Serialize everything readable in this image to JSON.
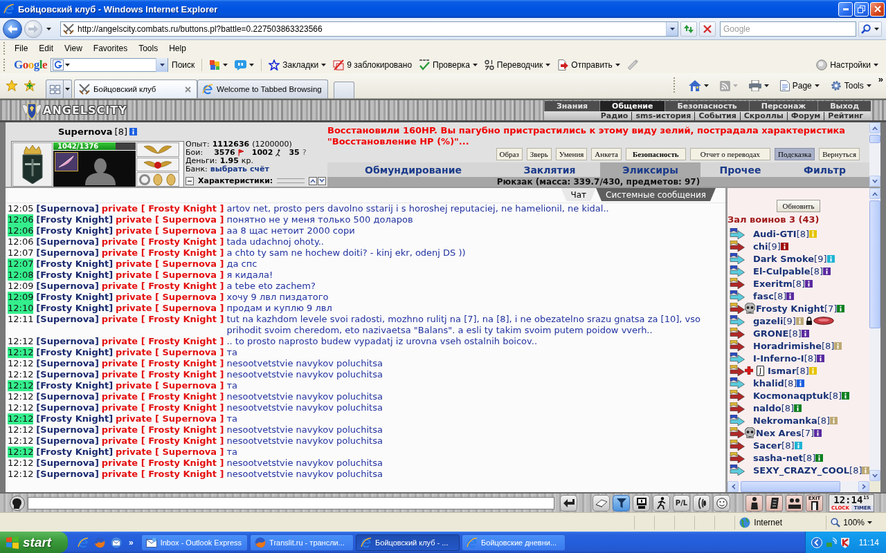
{
  "window": {
    "title": "Бойцовский клуб - Windows Internet Explorer"
  },
  "address_bar": {
    "url": "http://angelscity.combats.ru/buttons.pl?battle=0.227503863323566"
  },
  "search": {
    "placeholder": "Google"
  },
  "menu": [
    "File",
    "Edit",
    "View",
    "Favorites",
    "Tools",
    "Help"
  ],
  "google_toolbar": {
    "logo": "Google",
    "search_button": "Поиск",
    "items": [
      {
        "kind": "blocks",
        "dropdown": true
      },
      {
        "kind": "bubble",
        "dropdown": true
      },
      {
        "kind": "bookmarks",
        "label": "Закладки",
        "dropdown": true
      },
      {
        "kind": "blocked",
        "label": "9 заблокировано",
        "dropdown": false
      },
      {
        "kind": "spell",
        "label": "Проверка",
        "dropdown": true
      },
      {
        "kind": "translate",
        "label": "Переводчик",
        "dropdown": true
      },
      {
        "kind": "send",
        "label": "Отправить",
        "dropdown": true
      },
      {
        "kind": "marker",
        "dropdown": false
      }
    ],
    "settings": "Настройки"
  },
  "tabs": [
    {
      "title": "Бойцовский клуб",
      "selected": true
    },
    {
      "title": "Welcome to Tabbed Browsing",
      "selected": false
    }
  ],
  "command_bar": {
    "items": [
      {
        "kind": "home"
      },
      {
        "kind": "feeds"
      },
      {
        "kind": "print"
      },
      {
        "kind": "page",
        "label": "Page"
      },
      {
        "kind": "tools",
        "label": "Tools"
      }
    ],
    "more": "»"
  },
  "game": {
    "logo": "ANGELSCITY",
    "nav": [
      {
        "label": "Знания",
        "selected": false
      },
      {
        "label": "Общение",
        "selected": true
      },
      {
        "label": "Безопасность",
        "selected": false
      },
      {
        "label": "Персонаж",
        "selected": false
      },
      {
        "label": "Выход",
        "selected": false
      }
    ],
    "subnav": [
      "Радио",
      "sms-история",
      "События",
      "Скроллы",
      "Форум",
      "Рейтинг"
    ],
    "character": {
      "name": "Supernova",
      "rank": "[8]",
      "hp": {
        "reading": "1042/1376",
        "level": 0.757
      },
      "experience": {
        "label": "Опыт:",
        "value": "1112636",
        "next": "(1200000)"
      },
      "battles": {
        "label": "Бои:",
        "wins": "3576",
        "losses": "1002",
        "draws": "35",
        "draws_symbol": "?"
      },
      "money": {
        "label": "Деньги:",
        "value": "1.95",
        "unit": "кр."
      },
      "bank": {
        "label": "Банк:",
        "link": "выбрать счёт"
      },
      "characteristics": {
        "label": "Характеристики:",
        "expanded": true
      }
    },
    "notice": "Восстановили 160HP. Вы пагубно пристрастились к этому виду зелий, пострадала характеристика \"Восстановление HP (%)\"...",
    "actions": [
      {
        "label": "Образ",
        "kind": "normal",
        "selected": false
      },
      {
        "label": "Зверь",
        "kind": "normal",
        "selected": false
      },
      {
        "label": "Умения",
        "kind": "normal",
        "selected": false
      },
      {
        "label": "Анкета",
        "kind": "normal",
        "selected": false
      },
      {
        "label": "Безопасность",
        "kind": "strong",
        "selected": false
      },
      {
        "label": "Отчет о переводах",
        "kind": "wide",
        "selected": false
      },
      {
        "label": "Подсказка",
        "kind": "normal",
        "selected": true
      },
      {
        "label": "Вернуться",
        "kind": "normal",
        "selected": false
      }
    ],
    "inventory_tabs": [
      {
        "label": "Обмундирование",
        "selected": false
      },
      {
        "label": "Заклятия",
        "selected": false
      },
      {
        "label": "Эликсиры",
        "selected": true
      },
      {
        "label": "Прочее",
        "selected": false
      },
      {
        "label": "Фильтр",
        "selected": false
      }
    ],
    "backpack": "Рюкзак (масса: 339.7/430, предметов: 97)"
  },
  "chat": {
    "tabs": [
      {
        "label": "Чат",
        "selected": true
      },
      {
        "label": "Системные сообщения",
        "selected": false
      }
    ],
    "messages": [
      {
        "time": "12:05",
        "time_highlighted": false,
        "sender": "[Supernova]",
        "recipient": "private [ Frosty Knight ]",
        "text": "artov net, prosto pers davolno sstarij i s horoshej reputaciej, ne hamelionil, ne kidal.."
      },
      {
        "time": "12:06",
        "time_highlighted": true,
        "sender": "[Frosty Knight]",
        "recipient": "private [ Supernova ]",
        "text": "понятно не у меня только 500 доларов"
      },
      {
        "time": "12:06",
        "time_highlighted": true,
        "sender": "[Frosty Knight]",
        "recipient": "private [ Supernova ]",
        "text": "аа 8 щас нетоит 2000 сори"
      },
      {
        "time": "12:06",
        "time_highlighted": false,
        "sender": "[Supernova]",
        "recipient": "private [ Frosty Knight ]",
        "text": "tada udachnoj ohoty.."
      },
      {
        "time": "12:07",
        "time_highlighted": false,
        "sender": "[Supernova]",
        "recipient": "private [ Frosty Knight ]",
        "text": "a chto ty sam ne hochew doiti? - kinj ekr, odenj DS ))"
      },
      {
        "time": "12:07",
        "time_highlighted": true,
        "sender": "[Frosty Knight]",
        "recipient": "private [ Supernova ]",
        "text": "да спс"
      },
      {
        "time": "12:08",
        "time_highlighted": true,
        "sender": "[Frosty Knight]",
        "recipient": "private [ Supernova ]",
        "text": "я кидала!"
      },
      {
        "time": "12:09",
        "time_highlighted": false,
        "sender": "[Supernova]",
        "recipient": "private [ Frosty Knight ]",
        "text": "a tebe eto zachem?"
      },
      {
        "time": "12:09",
        "time_highlighted": true,
        "sender": "[Frosty Knight]",
        "recipient": "private [ Supernova ]",
        "text": "хочу 9 лвл пиздатого"
      },
      {
        "time": "12:10",
        "time_highlighted": true,
        "sender": "[Frosty Knight]",
        "recipient": "private [ Supernova ]",
        "text": "продам и куплю 9 лвл"
      },
      {
        "time": "12:11",
        "time_highlighted": false,
        "sender": "[Supernova]",
        "recipient": "private [ Frosty Knight ]",
        "text": "tut na kazhdom levele svoi radosti, mozhno rulitj na [7], na [8], i ne obezatelno srazu gnatsa za [10], vso prihodit svoim cheredom, eto nazivaetsa \"Balans\". a esli ty takim svoim putem poidow vverh.."
      },
      {
        "time": "12:12",
        "time_highlighted": false,
        "sender": "[Supernova]",
        "recipient": "private [ Frosty Knight ]",
        "text": ".. to prosto naprosto budew vypadatj iz urovna vseh ostalnih boicov.."
      },
      {
        "time": "12:12",
        "time_highlighted": true,
        "sender": "[Frosty Knight]",
        "recipient": "private [ Supernova ]",
        "text": "та"
      },
      {
        "time": "12:12",
        "time_highlighted": false,
        "sender": "[Supernova]",
        "recipient": "private [ Frosty Knight ]",
        "text": "nesootvetstvie navykov poluchitsa"
      },
      {
        "time": "12:12",
        "time_highlighted": false,
        "sender": "[Supernova]",
        "recipient": "private [ Frosty Knight ]",
        "text": "nesootvetstvie navykov poluchitsa"
      },
      {
        "time": "12:12",
        "time_highlighted": true,
        "sender": "[Frosty Knight]",
        "recipient": "private [ Supernova ]",
        "text": "та"
      },
      {
        "time": "12:12",
        "time_highlighted": false,
        "sender": "[Supernova]",
        "recipient": "private [ Frosty Knight ]",
        "text": "nesootvetstvie navykov poluchitsa"
      },
      {
        "time": "12:12",
        "time_highlighted": false,
        "sender": "[Supernova]",
        "recipient": "private [ Frosty Knight ]",
        "text": "nesootvetstvie navykov poluchitsa"
      },
      {
        "time": "12:12",
        "time_highlighted": true,
        "sender": "[Frosty Knight]",
        "recipient": "private [ Supernova ]",
        "text": "та"
      },
      {
        "time": "12:12",
        "time_highlighted": false,
        "sender": "[Supernova]",
        "recipient": "private [ Frosty Knight ]",
        "text": "nesootvetstvie navykov poluchitsa"
      },
      {
        "time": "12:12",
        "time_highlighted": false,
        "sender": "[Supernova]",
        "recipient": "private [ Frosty Knight ]",
        "text": "nesootvetstvie navykov poluchitsa"
      },
      {
        "time": "12:12",
        "time_highlighted": true,
        "sender": "[Frosty Knight]",
        "recipient": "private [ Supernova ]",
        "text": "та"
      },
      {
        "time": "12:12",
        "time_highlighted": false,
        "sender": "[Supernova]",
        "recipient": "private [ Frosty Knight ]",
        "text": "nesootvetstvie navykov poluchitsa"
      },
      {
        "time": "12:12",
        "time_highlighted": false,
        "sender": "[Supernova]",
        "recipient": "private [ Frosty Knight ]",
        "text": "nesootvetstvie navykov poluchitsa"
      }
    ]
  },
  "users": {
    "refresh": "Обновить",
    "title": "Зал воинов 3 (43)",
    "items": [
      {
        "name": "Audi-GTI",
        "rank": "[8]",
        "kind": "blue",
        "color": "#e6c400"
      },
      {
        "name": "chi",
        "rank": "[9]",
        "kind": "red",
        "color": "#a00c0c"
      },
      {
        "name": "Dark Smoke",
        "rank": "[9]",
        "kind": "blue",
        "color": "#1eb4d4"
      },
      {
        "name": "El-Culpable",
        "rank": "[8]",
        "kind": "blue",
        "color": "#5a2aa0"
      },
      {
        "name": "Exeritm",
        "rank": "[8]",
        "kind": "red",
        "color": "#5a2aa0"
      },
      {
        "name": "fasc",
        "rank": "[8]",
        "kind": "blue",
        "color": "#5a2aa0"
      },
      {
        "name": "Frosty Knight",
        "rank": "[7]",
        "kind": "red",
        "color": "#0e8020",
        "marks": [
          {
            "kind": "skull"
          }
        ]
      },
      {
        "name": "gazeli",
        "rank": "[9]",
        "kind": "blue",
        "color": "#bca874",
        "after": [
          {
            "kind": "lock"
          },
          {
            "kind": "oval"
          }
        ]
      },
      {
        "name": "GRONE",
        "rank": "[8]",
        "kind": "red",
        "color": "#5a2aa0"
      },
      {
        "name": "Horadrimishe",
        "rank": "[8]",
        "kind": "red",
        "color": "#bca874"
      },
      {
        "name": "I-Inferno-I",
        "rank": "[8]",
        "kind": "blue",
        "color": "#5a2aa0"
      },
      {
        "name": "Ismar",
        "rank": "[8]",
        "kind": "red",
        "color": "#e6c400",
        "marks": [
          {
            "kind": "cross"
          },
          {
            "kind": "card",
            "label": "J"
          }
        ]
      },
      {
        "name": "khalid",
        "rank": "[8]",
        "kind": "blue",
        "color": "#1a5ee0"
      },
      {
        "name": "Kocmonaqptuk",
        "rank": "[8]",
        "kind": "red",
        "color": "#0e8020"
      },
      {
        "name": "naldo",
        "rank": "[8]",
        "kind": "red",
        "color": "#0e8020"
      },
      {
        "name": "Nekromanka",
        "rank": "[8]",
        "kind": "blue",
        "color": "#bca874"
      },
      {
        "name": "Nex Ares",
        "rank": "[7]",
        "kind": "red",
        "color": "#5a2aa0",
        "marks": [
          {
            "kind": "skull"
          }
        ]
      },
      {
        "name": "Sacer",
        "rank": "[8]",
        "kind": "red",
        "color": "#1eb4d4"
      },
      {
        "name": "sasha-net",
        "rank": "[8]",
        "kind": "red",
        "color": "#0e8020"
      },
      {
        "name": "SEXY_CRAZY_COOL",
        "rank": "[8]",
        "kind": "blue",
        "color": "#bca874"
      }
    ]
  },
  "chat_bar": {
    "items": [
      {
        "kind": "enter",
        "selected": false
      },
      {
        "kind": "eraser",
        "selected": false
      },
      {
        "kind": "filter",
        "selected": true
      },
      {
        "kind": "monitor",
        "selected": false
      },
      {
        "kind": "walker",
        "selected": false
      },
      {
        "kind": "pl",
        "label": "P/L",
        "selected": false
      },
      {
        "kind": "sound",
        "selected": false
      },
      {
        "kind": "smile",
        "selected": false
      }
    ],
    "right_items": [
      {
        "kind": "figure"
      },
      {
        "kind": "scroll"
      },
      {
        "kind": "people"
      },
      {
        "kind": "exit",
        "label": "EXIT"
      }
    ],
    "clock": {
      "time": "12:14",
      "seconds": "15",
      "clock_label": "CLOCK",
      "timer_label": "TIMER"
    }
  },
  "status_bar": {
    "zone": "Internet",
    "zoom": "100%"
  },
  "taskbar": {
    "start": "start",
    "quick_launch": [
      {
        "kind": "ie"
      },
      {
        "kind": "firefox"
      },
      {
        "kind": "outlook"
      }
    ],
    "more": "»",
    "tasks": [
      {
        "label": "Inbox - Outlook Express",
        "kind": "mail",
        "selected": false
      },
      {
        "label": "Translit.ru - трансли...",
        "kind": "firefox",
        "selected": false
      },
      {
        "label": "Бойцовский клуб - ...",
        "kind": "ie",
        "selected": true
      },
      {
        "label": "Бойцовские дневни...",
        "kind": "ie",
        "selected": false
      }
    ],
    "tray": [
      {
        "kind": "arrow"
      },
      {
        "kind": "network"
      },
      {
        "kind": "antivirus"
      }
    ],
    "time": "11:14"
  }
}
